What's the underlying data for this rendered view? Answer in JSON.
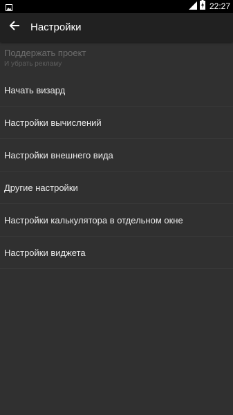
{
  "status_bar": {
    "time": "22:27",
    "icons": [
      "image-notification-icon",
      "signal-icon",
      "battery-charging-icon"
    ]
  },
  "toolbar": {
    "title": "Настройки",
    "back_icon": "arrow-left-icon"
  },
  "settings": {
    "items": [
      {
        "title": "Поддержать проект",
        "summary": "И убрать рекламу",
        "enabled": false
      },
      {
        "title": "Начать визард"
      },
      {
        "title": "Настройки вычислений"
      },
      {
        "title": "Настройки внешнего вида"
      },
      {
        "title": "Другие настройки"
      },
      {
        "title": "Настройки калькулятора в отдельном окне"
      },
      {
        "title": "Настройки виджета"
      }
    ]
  },
  "colors": {
    "background": "#303030",
    "toolbar": "#212121",
    "status_bar": "#000000",
    "text_primary": "#ececec",
    "text_disabled": "#6d6d6d"
  }
}
